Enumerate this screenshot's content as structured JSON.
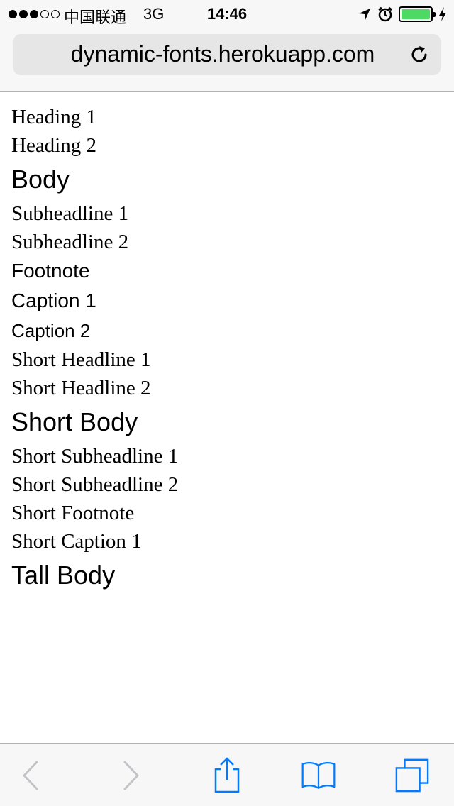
{
  "status_bar": {
    "carrier": "中国联通",
    "network": "3G",
    "time": "14:46",
    "signal_bars_filled": 3,
    "signal_bars_total": 5,
    "battery_level": 1.0,
    "icons": [
      "location-arrow-icon",
      "alarm-clock-icon",
      "battery-icon",
      "charging-bolt-icon"
    ]
  },
  "browser": {
    "url": "dynamic-fonts.herokuapp.com",
    "reload_icon": "reload-icon"
  },
  "content": {
    "items": [
      "Heading 1",
      "Heading 2",
      "Body",
      "Subheadline 1",
      "Subheadline 2",
      "Footnote",
      "Caption 1",
      "Caption 2",
      "Short Headline 1",
      "Short Headline 2",
      "Short Body",
      "Short Subheadline 1",
      "Short Subheadline 2",
      "Short Footnote",
      "Short Caption 1",
      "Tall Body"
    ]
  },
  "toolbar": {
    "icons": [
      "back-icon",
      "forward-icon",
      "share-icon",
      "bookmarks-icon",
      "tabs-icon"
    ],
    "accent_color": "#007aff",
    "disabled_color": "#c4c4c8"
  }
}
